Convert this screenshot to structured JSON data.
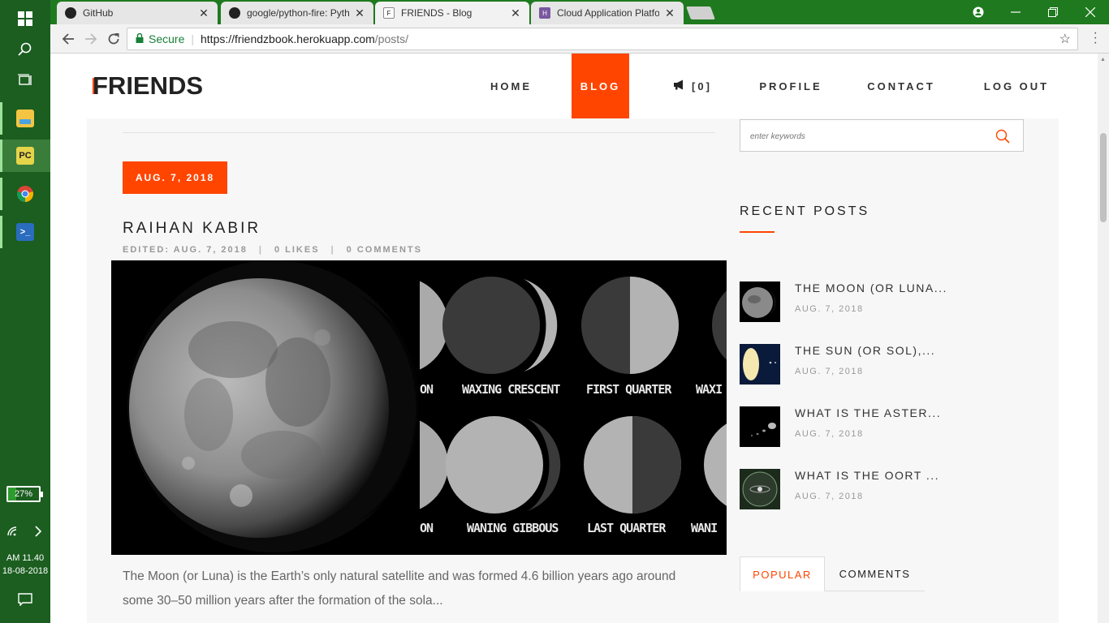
{
  "taskbar": {
    "battery_percent": "27%",
    "battery_level": 0.27,
    "clock_time": "AM 11.40",
    "clock_date": "18-08-2018"
  },
  "browser": {
    "tabs": [
      {
        "label": "GitHub",
        "close": "✕"
      },
      {
        "label": "google/python-fire: Pyth",
        "close": "✕"
      },
      {
        "label": "FRIENDS - Blog",
        "close": "✕"
      },
      {
        "label": "Cloud Application Platfor",
        "close": "✕"
      }
    ],
    "secure_label": "Secure",
    "url_host": "https://friendzbook.herokuapp.com",
    "url_path": "/posts/"
  },
  "site": {
    "logo": "FRIENDS",
    "nav": {
      "home": "HOME",
      "blog": "BLOG",
      "notifications": "[0]",
      "profile": "PROFILE",
      "contact": "CONTACT",
      "logout": "LOG OUT"
    }
  },
  "post": {
    "date_badge": "AUG. 7, 2018",
    "author": "RAIHAN KABIR",
    "edited": "EDITED: AUG. 7, 2018",
    "likes": "0 LIKES",
    "comments": "0 COMMENTS",
    "separator": "|",
    "excerpt": "The Moon (or Luna) is the Earth’s only natural satellite and was formed 4.6 billion years ago around some 30–50 million years after the formation of the sola...",
    "phase_labels": {
      "top_left_partial": "ON",
      "waxing_crescent": "WAXING CRESCENT",
      "first_quarter": "FIRST QUARTER",
      "top_right_partial": "WAXI",
      "bottom_left_partial": "ON",
      "waning_gibbous": "WANING GIBBOUS",
      "last_quarter": "LAST QUARTER",
      "bottom_right_partial": "WANI"
    }
  },
  "sidebar": {
    "search_placeholder": "enter keywords",
    "recent_title": "RECENT POSTS",
    "recent_posts": [
      {
        "title": "THE MOON (OR LUNA...",
        "date": "AUG. 7, 2018"
      },
      {
        "title": "THE SUN (OR SOL),...",
        "date": "AUG. 7, 2018"
      },
      {
        "title": "WHAT IS THE ASTER...",
        "date": "AUG. 7, 2018"
      },
      {
        "title": "WHAT IS THE OORT ...",
        "date": "AUG. 7, 2018"
      }
    ],
    "tabs": {
      "popular": "POPULAR",
      "comments": "COMMENTS"
    }
  },
  "colors": {
    "accent": "#ff4500",
    "taskbar": "#1b5e20",
    "tabstrip": "#1f7a1f"
  }
}
